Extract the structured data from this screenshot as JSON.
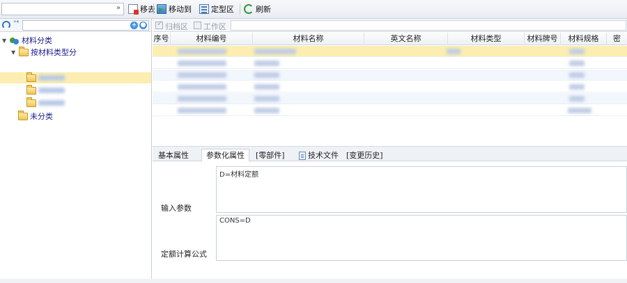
{
  "toolbar": {
    "combo_value": "",
    "combo_arrow": "»",
    "move_away_label": "移去",
    "move_to_label": "移动到",
    "region_label": "定型区",
    "refresh_label": "刷新"
  },
  "left_panel": {
    "filter_glyph": "°⁴",
    "search_value": "",
    "tree": {
      "root": "材料分类",
      "child": "按材料类型分",
      "uncategorized": "未分类"
    }
  },
  "right_panel": {
    "archive_label": "归档区",
    "work_label": "工作区",
    "filter_value": ""
  },
  "grid": {
    "columns": [
      "序号",
      "材料编号",
      "材料名称",
      "英文名称",
      "材料类型",
      "材料牌号",
      "材料规格",
      "密"
    ]
  },
  "tabs": [
    "基本属性",
    "参数化属性",
    "[零部件]",
    "技术文件",
    "[变更历史]"
  ],
  "form": {
    "input_param_label": "输入参数",
    "input_param_value": "D=材料定额",
    "formula_label": "定额计算公式",
    "formula_value": "CONS=D"
  },
  "icons": {
    "move_away": "document-remove-icon",
    "move_to": "folder-move-icon",
    "region": "list-window-icon",
    "refresh": "refresh-icon"
  },
  "colors": {
    "selection": "#fbeeb0",
    "tree_text": "#1a1a8c",
    "alt_row": "#f2f6fd"
  }
}
